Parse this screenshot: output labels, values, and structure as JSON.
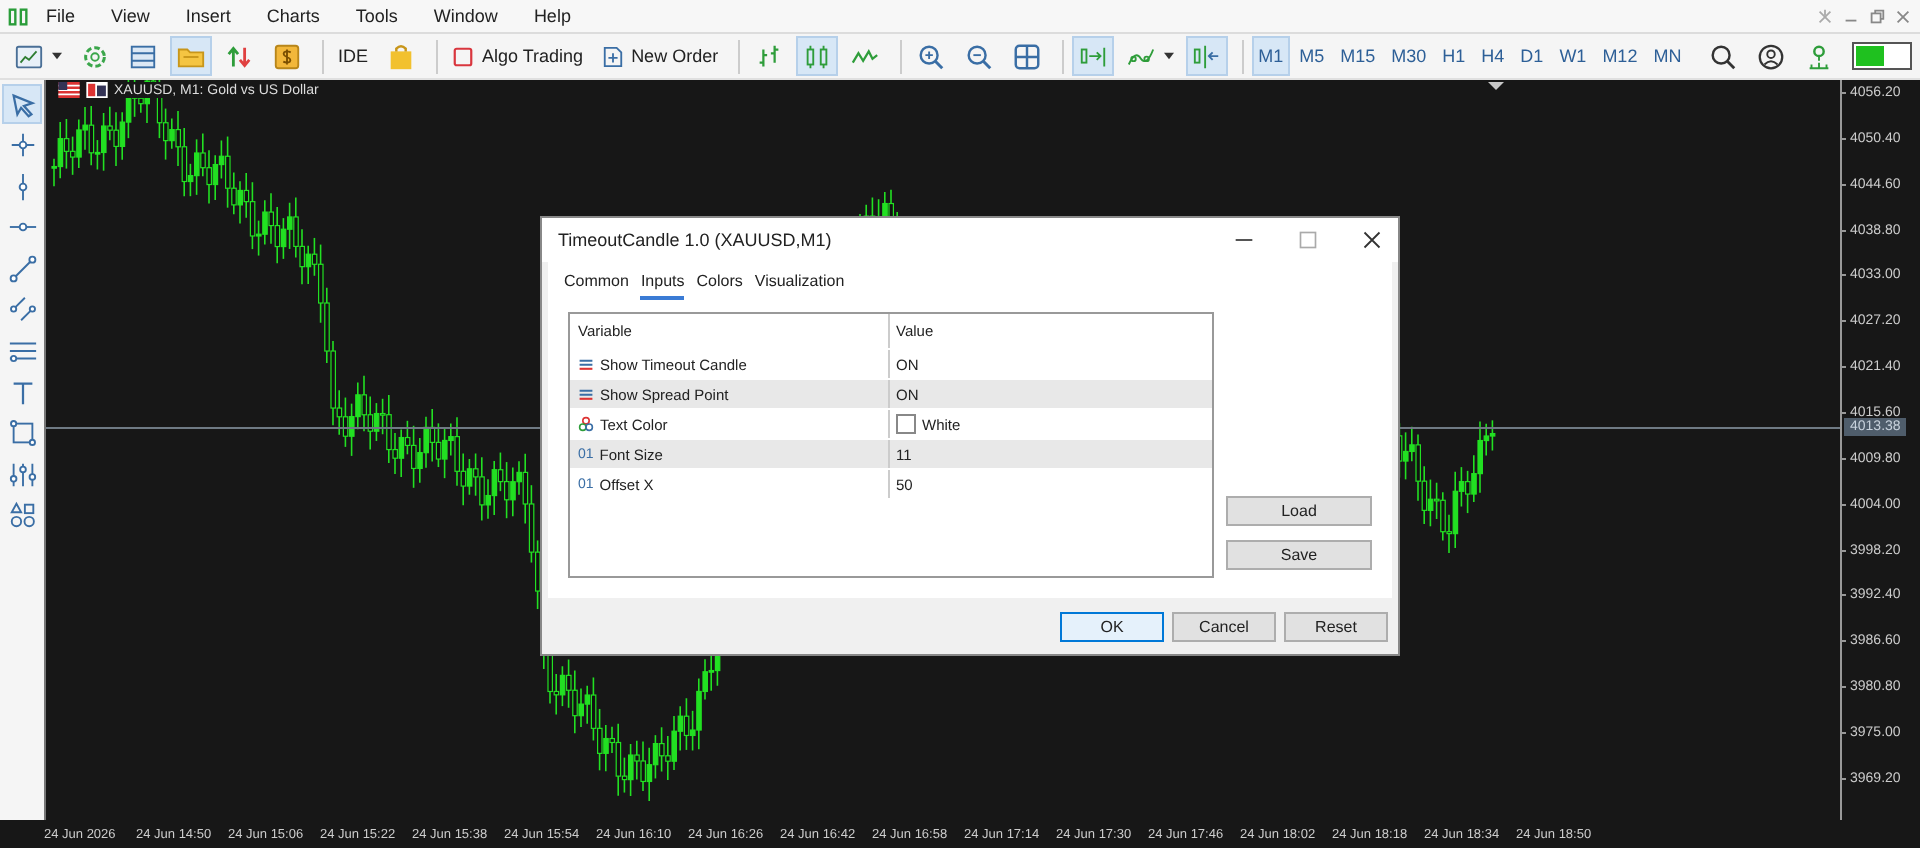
{
  "menu": [
    "File",
    "View",
    "Insert",
    "Charts",
    "Tools",
    "Window",
    "Help"
  ],
  "toolbar": {
    "tool_groups": [
      [
        {
          "kind": "chart-type",
          "on": false
        },
        {
          "kind": "settings",
          "on": false
        },
        {
          "kind": "template",
          "on": false
        },
        {
          "kind": "folder",
          "on": true
        },
        {
          "kind": "trade-arrows",
          "on": false
        },
        {
          "kind": "dollar",
          "on": false
        }
      ],
      [
        {
          "kind": "text",
          "label": "IDE",
          "on": false
        },
        {
          "kind": "bag",
          "on": false
        }
      ],
      [
        {
          "kind": "algo",
          "label": "Algo Trading",
          "on": false
        },
        {
          "kind": "order",
          "label": "New Order",
          "on": false
        }
      ],
      [
        {
          "kind": "bars",
          "on": false
        },
        {
          "kind": "candles",
          "on": true
        },
        {
          "kind": "line",
          "on": false
        }
      ],
      [
        {
          "kind": "zoom-in",
          "on": false
        },
        {
          "kind": "zoom-out",
          "on": false
        },
        {
          "kind": "tile",
          "on": false
        }
      ],
      [
        {
          "kind": "autoscroll",
          "on": true
        },
        {
          "kind": "indicators",
          "on": false
        },
        {
          "kind": "shift",
          "on": true
        }
      ]
    ],
    "timeframes": [
      {
        "label": "M1",
        "selected": true
      },
      {
        "label": "M5",
        "selected": false
      },
      {
        "label": "M15",
        "selected": false
      },
      {
        "label": "M30",
        "selected": false
      },
      {
        "label": "H1",
        "selected": false
      },
      {
        "label": "H4",
        "selected": false
      },
      {
        "label": "D1",
        "selected": false
      },
      {
        "label": "W1",
        "selected": false
      },
      {
        "label": "M12",
        "selected": false
      },
      {
        "label": "MN",
        "selected": false
      }
    ]
  },
  "drawing_tools": [
    {
      "kind": "cursor",
      "selected": true
    },
    {
      "kind": "crosshair",
      "selected": false
    },
    {
      "kind": "vline",
      "selected": false
    },
    {
      "kind": "hline",
      "selected": false
    },
    {
      "kind": "trendline",
      "selected": false
    },
    {
      "kind": "channel",
      "selected": false
    },
    {
      "kind": "fibo",
      "selected": false
    },
    {
      "kind": "text",
      "selected": false
    },
    {
      "kind": "rectangle",
      "selected": false
    },
    {
      "kind": "sliders",
      "selected": false
    },
    {
      "kind": "shapes",
      "selected": false
    }
  ],
  "chart": {
    "title": "XAUUSD, M1:  Gold vs US Dollar",
    "price_labels": [
      "4056.20",
      "4050.40",
      "4044.60",
      "4038.80",
      "4033.00",
      "4027.20",
      "4021.40",
      "4015.60",
      "4009.80",
      "4004.00",
      "3998.20",
      "3992.40",
      "3986.60",
      "3980.80",
      "3975.00",
      "3969.20"
    ],
    "current_price": "4013.38",
    "time_labels": [
      "24 Jun 2026",
      "24 Jun 14:50",
      "24 Jun 15:06",
      "24 Jun 15:22",
      "24 Jun 15:38",
      "24 Jun 15:54",
      "24 Jun 16:10",
      "24 Jun 16:26",
      "24 Jun 16:42",
      "24 Jun 16:58",
      "24 Jun 17:14",
      "24 Jun 17:30",
      "24 Jun 17:46",
      "24 Jun 18:02",
      "24 Jun 18:18",
      "24 Jun 18:34",
      "24 Jun 18:50"
    ]
  },
  "dialog": {
    "title": "TimeoutCandle 1.0 (XAUUSD,M1)",
    "tabs": [
      {
        "label": "Common",
        "selected": false
      },
      {
        "label": "Inputs",
        "selected": true
      },
      {
        "label": "Colors",
        "selected": false
      },
      {
        "label": "Visualization",
        "selected": false
      }
    ],
    "columns": [
      "Variable",
      "Value"
    ],
    "rows": [
      {
        "kind": "bool",
        "variable": "Show Timeout Candle",
        "value": "ON"
      },
      {
        "kind": "bool",
        "variable": "Show Spread Point",
        "value": "ON"
      },
      {
        "kind": "color",
        "variable": "Text Color",
        "value": "White",
        "color": "#ffffff"
      },
      {
        "kind": "int",
        "type_icon": "01",
        "variable": "Font Size",
        "value": "11"
      },
      {
        "kind": "int",
        "type_icon": "01",
        "variable": "Offset X",
        "value": "50"
      }
    ],
    "side_buttons": [
      "Load",
      "Save"
    ],
    "buttons": [
      {
        "label": "OK",
        "default": true
      },
      {
        "label": "Cancel",
        "default": false
      },
      {
        "label": "Reset",
        "default": false
      }
    ]
  }
}
